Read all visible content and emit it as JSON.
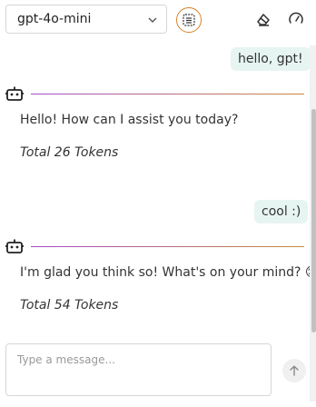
{
  "header": {
    "model": "gpt-4o-mini"
  },
  "icons": {
    "prompt": "prompt-list-icon",
    "clear": "eraser-icon",
    "stats": "gauge-icon",
    "bot": "robot-icon",
    "send": "arrow-up-icon",
    "dropdown": "chevron-down-icon"
  },
  "colors": {
    "accent_orange": "#d9822b",
    "user_bubble": "#e7f5f2",
    "divider_start": "#a64dc9",
    "divider_end": "#c98a3a"
  },
  "messages": [
    {
      "role": "user",
      "text": "hello, gpt!"
    },
    {
      "role": "assistant",
      "text": "Hello! How can I assist you today?",
      "tokens": "Total 26 Tokens"
    },
    {
      "role": "user",
      "text": "cool :)"
    },
    {
      "role": "assistant",
      "text": "I'm glad you think so! What's on your mind? 😊",
      "tokens": "Total 54 Tokens"
    }
  ],
  "composer": {
    "placeholder": "Type a message..."
  }
}
